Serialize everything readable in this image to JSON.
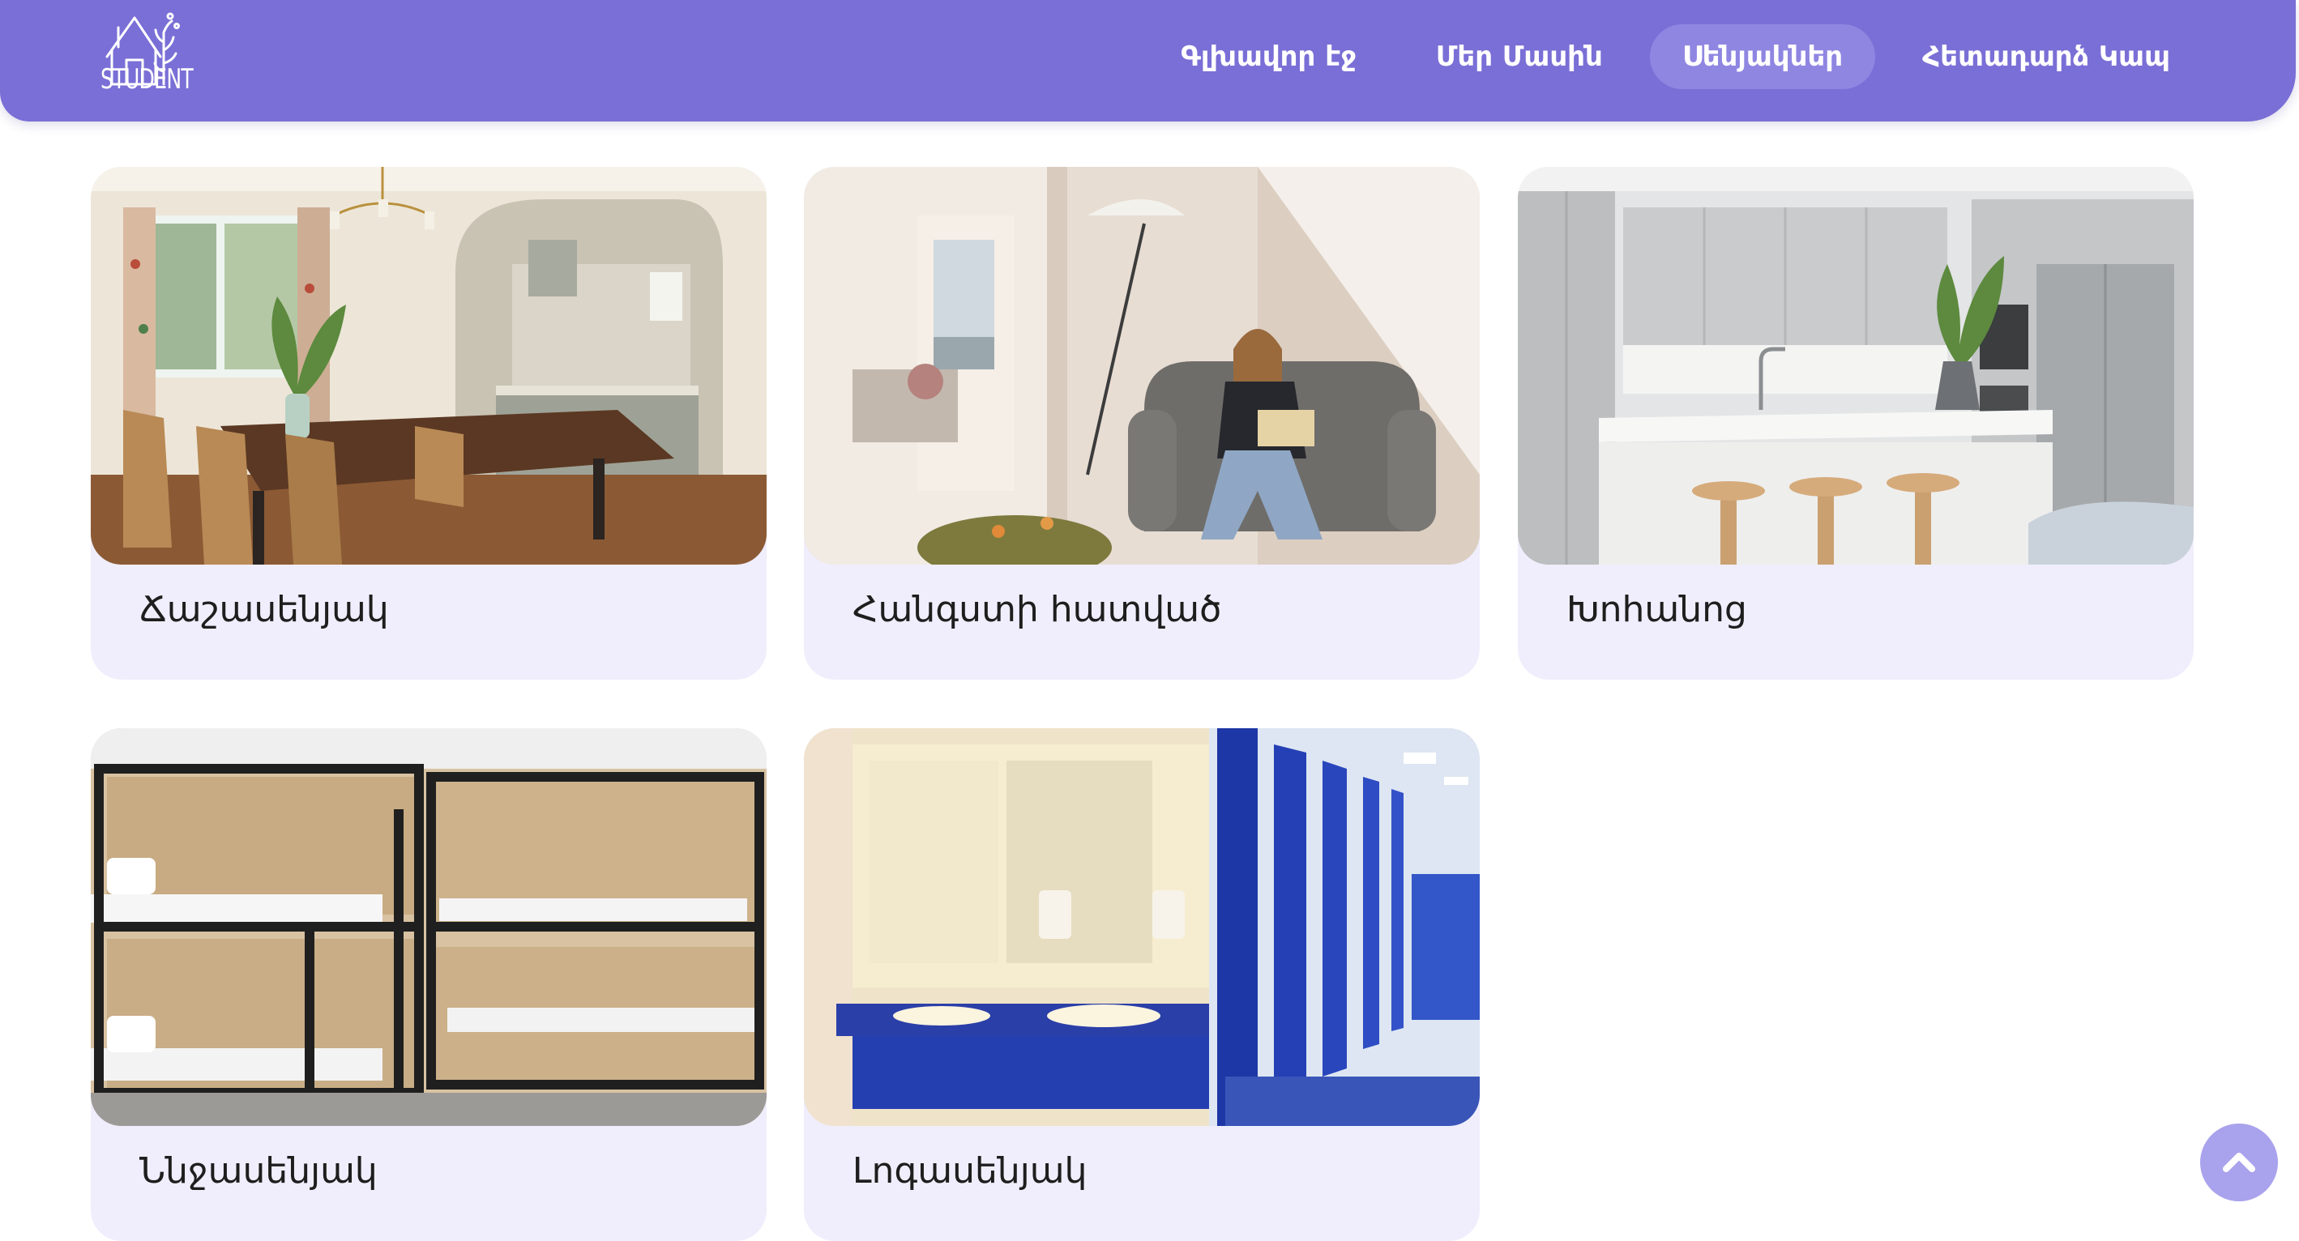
{
  "header": {
    "logo_text": "STUDENT",
    "nav": [
      {
        "label": "Գլխավոր էջ",
        "active": false
      },
      {
        "label": "Մեր Մասին",
        "active": false
      },
      {
        "label": "Սենյակներ",
        "active": true
      },
      {
        "label": "Հետադարձ Կապ",
        "active": false
      }
    ]
  },
  "rooms": [
    {
      "label": "Ճաշասենյակ",
      "image": "dining-room-with-kitchen-photo"
    },
    {
      "label": "Հանգստի հատված",
      "image": "lounge-reading-student-photo"
    },
    {
      "label": "Խոհանոց",
      "image": "modern-kitchen-photo"
    },
    {
      "label": "Ննջասենյակ",
      "image": "bunk-bed-dormitory-photo"
    },
    {
      "label": "Լոգասենյակ",
      "image": "shared-bathroom-photo"
    }
  ],
  "scroll_top": {
    "icon": "chevron-up-icon"
  },
  "colors": {
    "header": "#7a6fd6",
    "nav_active": "#8f86e2",
    "card_background": "#f0eefc",
    "scroll_button": "#a9a2ec"
  }
}
